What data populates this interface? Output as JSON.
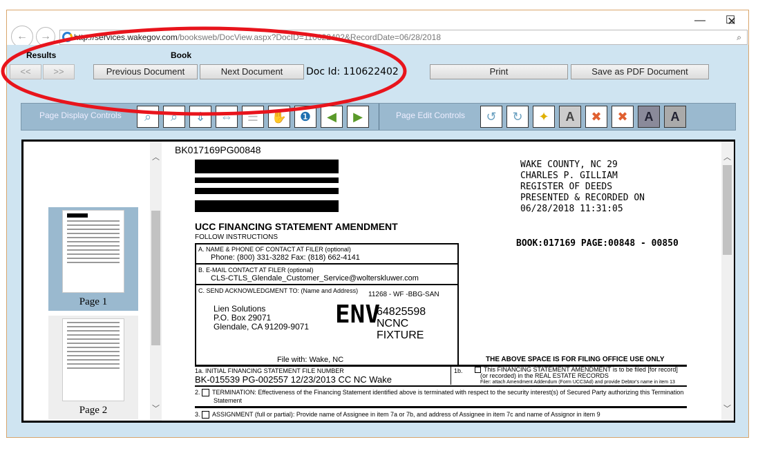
{
  "window": {
    "controls": {
      "minimize": "—",
      "maximize": "☐",
      "close": "✕"
    }
  },
  "browser": {
    "back": "←",
    "forward": "→",
    "url_host": "http://services.wakegov.com",
    "url_path": "/booksweb/DocView.aspx?DocID=110622402&RecordDate=06/28/2018",
    "search_icon": "⌕",
    "refresh_icon": "↻"
  },
  "toolbar": {
    "results_label": "Results",
    "book_label": "Book",
    "prev_results": "<<",
    "next_results": ">>",
    "previous_document": "Previous Document",
    "next_document": "Next Document",
    "doc_id": "Doc Id: 110622402",
    "print": "Print",
    "save_pdf": "Save as PDF Document"
  },
  "controls": {
    "display_label": "Page Display Controls",
    "edit_label": "Page Edit Controls",
    "display_icons": [
      "zoom-in",
      "zoom-out",
      "fit-height",
      "fit-width",
      "page-layout",
      "pan-hand",
      "page-number",
      "previous-page",
      "next-page"
    ],
    "edit_icons": [
      "rotate-left",
      "rotate-right",
      "magic-wand",
      "text-annotate",
      "delete-page",
      "delete-lines",
      "bold-a",
      "contrast-a"
    ]
  },
  "thumbnails": [
    {
      "label": "Page 1",
      "selected": true
    },
    {
      "label": "Page 2",
      "selected": false
    }
  ],
  "document": {
    "book_page": "BK017169PG00848",
    "stamp": [
      "WAKE COUNTY, NC  29",
      "CHARLES P. GILLIAM",
      "REGISTER OF DEEDS",
      "PRESENTED & RECORDED ON",
      "06/28/2018 11:31:05"
    ],
    "book_range": "BOOK:017169 PAGE:00848 - 00850",
    "title": "UCC FINANCING STATEMENT AMENDMENT",
    "follow": "FOLLOW INSTRUCTIONS",
    "a_label": "A. NAME & PHONE OF CONTACT AT FILER (optional)",
    "a_value": "Phone: (800) 331-3282 Fax: (818) 662-4141",
    "b_label": "B. E-MAIL CONTACT AT FILER (optional)",
    "b_value": "CLS-CTLS_Glendale_Customer_Service@wolterskluwer.com",
    "c_label": "C. SEND ACKNOWLEDGMENT TO: (Name and Address)",
    "c_code": "11268 - WF -BBG-SAN",
    "c_addr": [
      "Lien Solutions",
      "P.O. Box 29071",
      "Glendale, CA  91209-9071"
    ],
    "c_stamp": "ENV",
    "c_ref": [
      "64825598",
      "NCNC",
      "FIXTURE"
    ],
    "file_with": "File with: Wake, NC",
    "office_use": "THE ABOVE SPACE IS FOR FILING OFFICE USE ONLY",
    "1a_label": "1a. INITIAL FINANCING STATEMENT FILE NUMBER",
    "1a_value": "BK-015539 PG-002557   12/23/2013 CC NC Wake",
    "1b_num": "1b.",
    "1b_text": [
      "This FINANCING STATEMENT AMENDMENT is to be filed [for record]",
      "(or recorded) in the REAL ESTATE RECORDS",
      "Filer: attach Amendment Addendum (Form UCC3Ad) and provide Debtor's name in item 13"
    ],
    "item2": "2.",
    "item2_text": "TERMINATION: Effectiveness of the Financing Statement identified above is terminated with respect to the security interest(s) of Secured Party authorizing this Termination",
    "item2_text2": "Statement",
    "item3": "3.",
    "item3_text": "ASSIGNMENT (full or partial): Provide name of Assignee in item 7a or 7b, and address of Assignee in item 7c and name of Assignor in item 9"
  },
  "annotation_color": "#e8141c"
}
